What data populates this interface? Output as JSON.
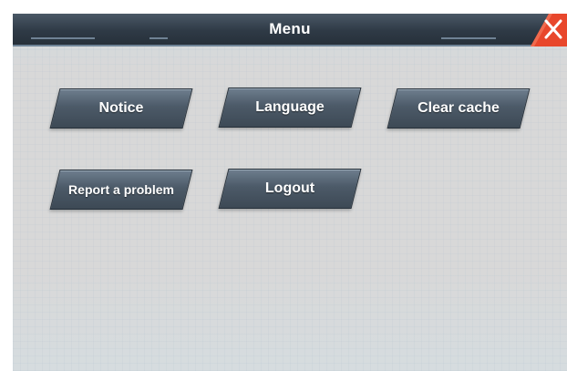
{
  "dialog": {
    "title": "Menu",
    "close_icon": "close-x-icon",
    "accent_color": "#e8472c"
  },
  "buttons": [
    {
      "label": "Notice"
    },
    {
      "label": "Language"
    },
    {
      "label": "Clear cache"
    },
    {
      "label": "Report a problem"
    },
    {
      "label": "Logout"
    }
  ]
}
